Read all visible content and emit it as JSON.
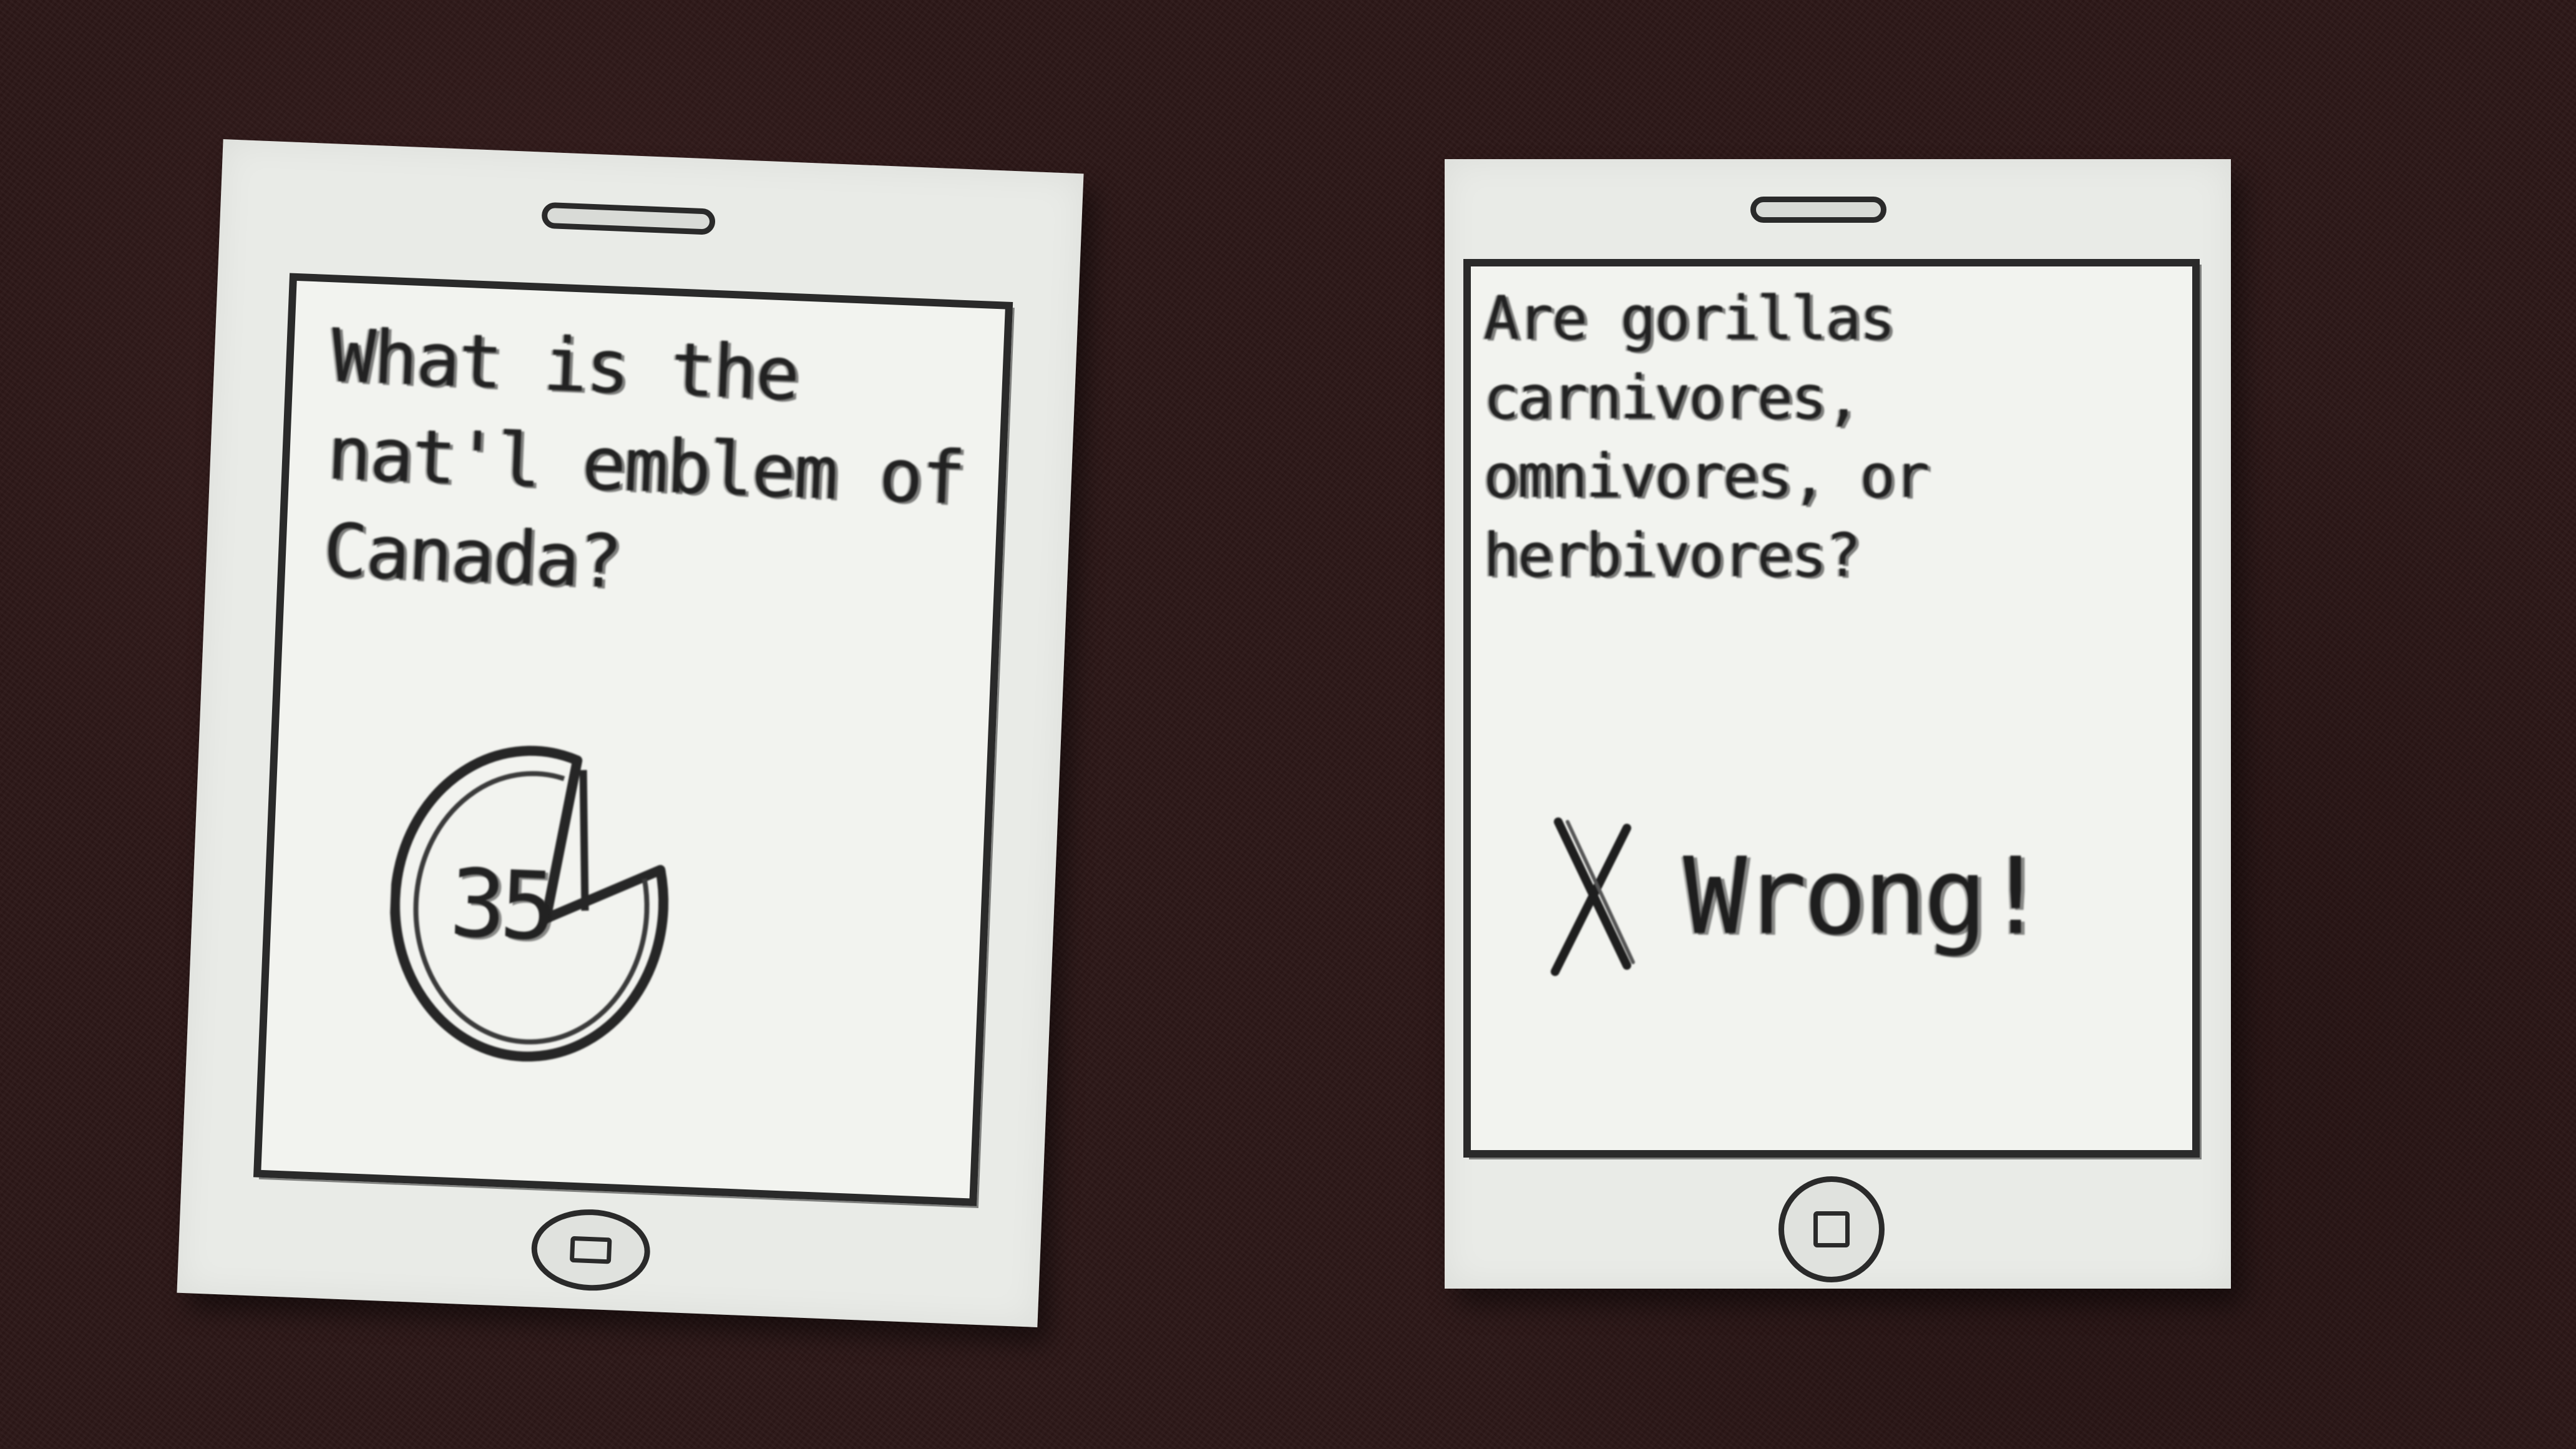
{
  "left_phone": {
    "question": "What is the nat'l emblem of Canada?",
    "timer": {
      "value": "35",
      "icon": "timer-pie-icon"
    },
    "home_button_icon": "home-button-icon"
  },
  "right_phone": {
    "question": "Are gorillas carnivores, omnivores, or herbivores?",
    "feedback": {
      "icon": "x-mark-icon",
      "text": "Wrong!"
    },
    "home_button_icon": "home-button-icon"
  },
  "colors": {
    "background": "#2d1818",
    "paper": "#e9ebe7",
    "ink": "#222222"
  }
}
